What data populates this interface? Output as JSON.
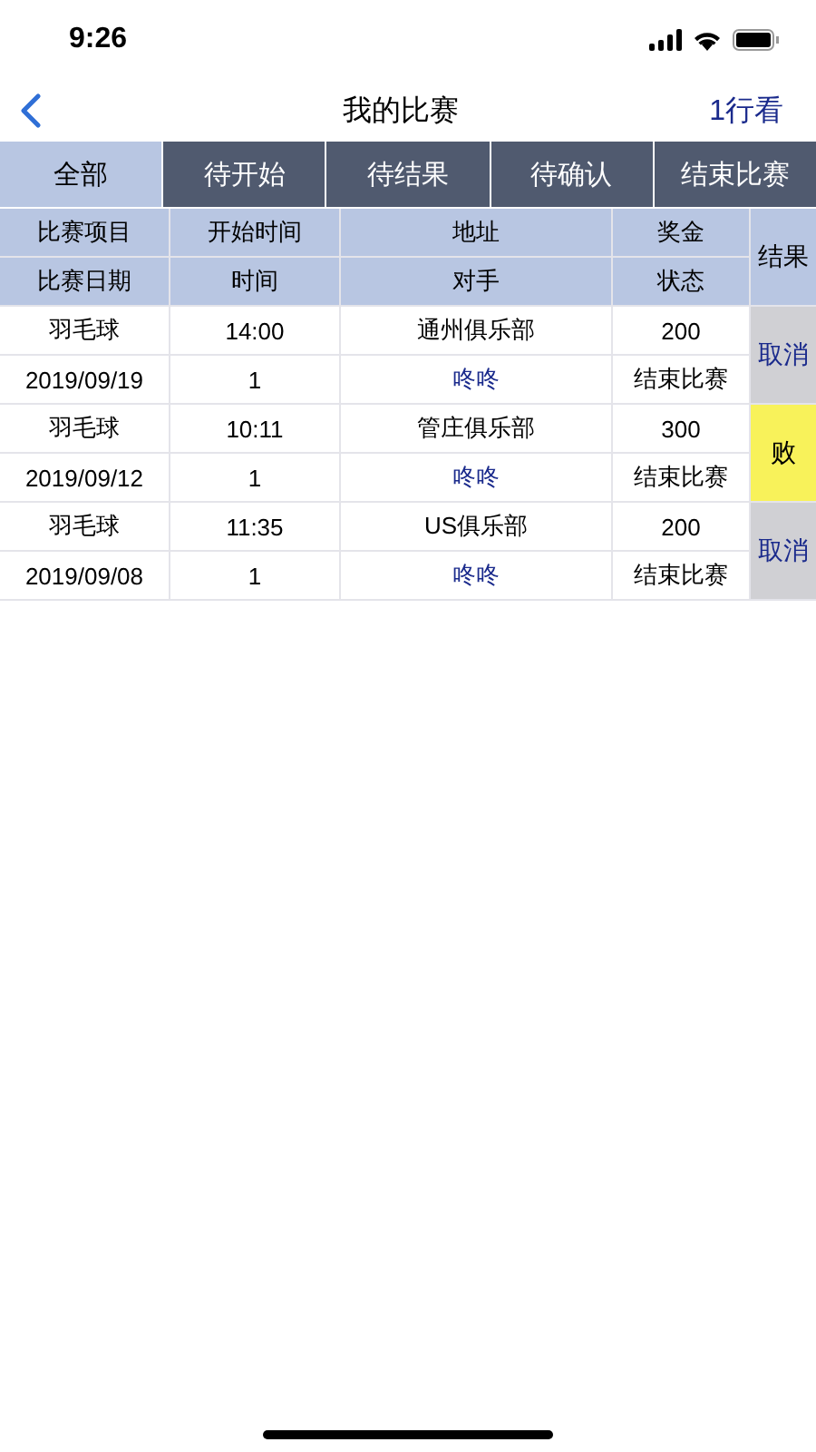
{
  "status_bar": {
    "time": "9:26"
  },
  "nav": {
    "title": "我的比赛",
    "action": "1行看"
  },
  "tabs": [
    {
      "label": "全部",
      "selected": true
    },
    {
      "label": "待开始",
      "selected": false
    },
    {
      "label": "待结果",
      "selected": false
    },
    {
      "label": "待确认",
      "selected": false
    },
    {
      "label": "结束比赛",
      "selected": false
    }
  ],
  "table": {
    "header_row_1": [
      "比赛项目",
      "开始时间",
      "地址",
      "奖金"
    ],
    "header_row_2": [
      "比赛日期",
      "时间",
      "对手",
      "状态"
    ],
    "result_header": "结果",
    "matches": [
      {
        "sport": "羽毛球",
        "start_time": "14:00",
        "address": "通州俱乐部",
        "prize": "200",
        "date": "2019/09/19",
        "time": "1",
        "opponent": "咚咚",
        "status": "结束比赛",
        "result": {
          "kind": "cancel",
          "text": "取消"
        }
      },
      {
        "sport": "羽毛球",
        "start_time": "10:11",
        "address": "管庄俱乐部",
        "prize": "300",
        "date": "2019/09/12",
        "time": "1",
        "opponent": "咚咚",
        "status": "结束比赛",
        "result": {
          "kind": "lose",
          "text": "败"
        }
      },
      {
        "sport": "羽毛球",
        "start_time": "11:35",
        "address": "US俱乐部",
        "prize": "200",
        "date": "2019/09/08",
        "time": "1",
        "opponent": "咚咚",
        "status": "结束比赛",
        "result": {
          "kind": "cancel",
          "text": "取消"
        }
      }
    ]
  }
}
